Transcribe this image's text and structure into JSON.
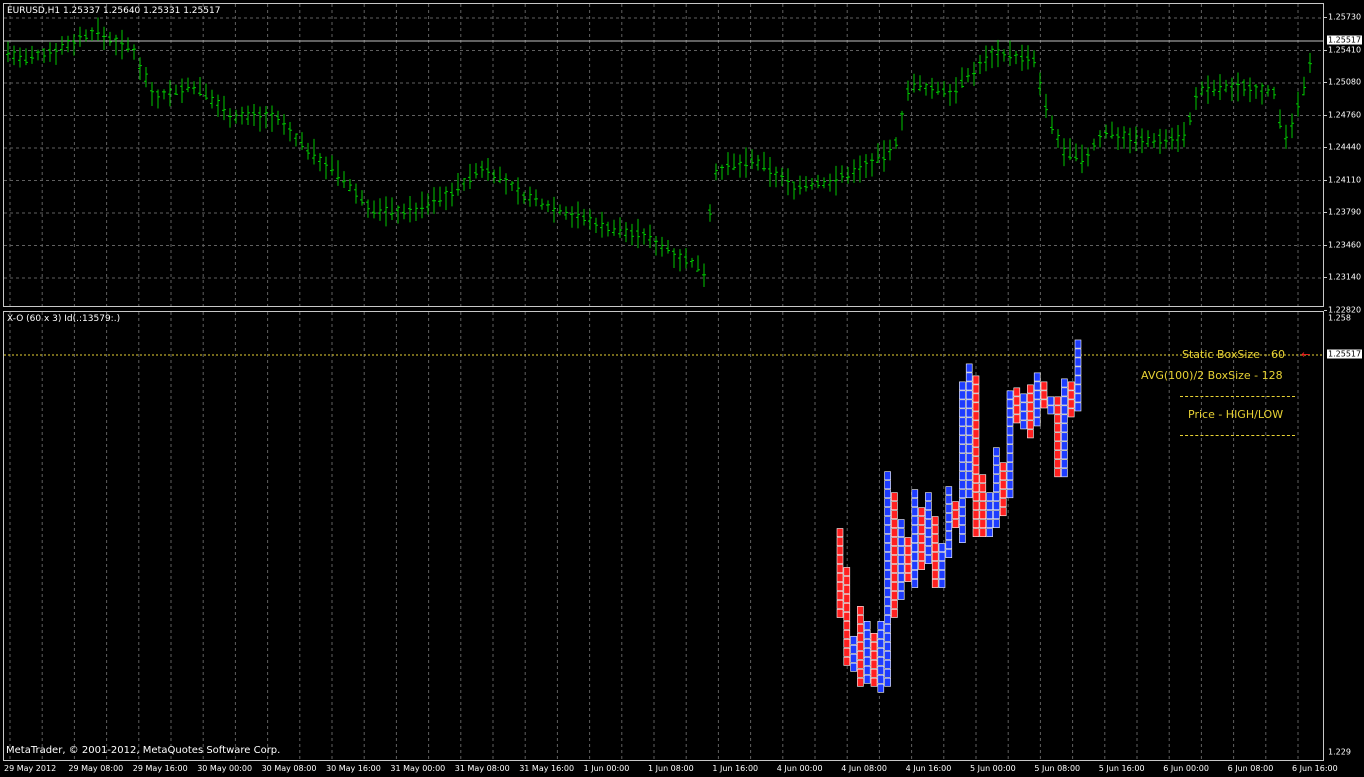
{
  "price_chart": {
    "title": "EURUSD,H1  1.25337 1.25640 1.25331 1.25517",
    "axis_labels": [
      "1.25730",
      "1.25410",
      "1.25080",
      "1.24760",
      "1.24440",
      "1.24110",
      "1.23790",
      "1.23460",
      "1.23140",
      "1.22820"
    ],
    "current_price": "1.25517"
  },
  "xo_chart": {
    "title": "X-O (60 x 3) Id(.:13579:.)",
    "axis_top": "1.258",
    "axis_bottom": "1.229",
    "current_price": "1.25517",
    "x_color": "#1e3cff",
    "o_color": "#ff2020",
    "columns": [
      {
        "type": "O",
        "top": 1.244,
        "bottom": 1.238
      },
      {
        "type": "O",
        "top": 1.2412,
        "bottom": 1.2348
      },
      {
        "type": "X",
        "top": 1.2366,
        "bottom": 1.2344
      },
      {
        "type": "O",
        "top": 1.2384,
        "bottom": 1.2334
      },
      {
        "type": "X",
        "top": 1.2378,
        "bottom": 1.2336
      },
      {
        "type": "O",
        "top": 1.2366,
        "bottom": 1.2334
      },
      {
        "type": "X",
        "top": 1.2374,
        "bottom": 1.233
      },
      {
        "type": "X",
        "top": 1.2474,
        "bottom": 1.2334
      },
      {
        "type": "O",
        "top": 1.246,
        "bottom": 1.238
      },
      {
        "type": "X",
        "top": 1.2444,
        "bottom": 1.2392
      },
      {
        "type": "O",
        "top": 1.243,
        "bottom": 1.2404
      },
      {
        "type": "X",
        "top": 1.2466,
        "bottom": 1.24
      },
      {
        "type": "O",
        "top": 1.2454,
        "bottom": 1.2412
      },
      {
        "type": "X",
        "top": 1.246,
        "bottom": 1.2416
      },
      {
        "type": "O",
        "top": 1.2448,
        "bottom": 1.24
      },
      {
        "type": "X",
        "top": 1.243,
        "bottom": 1.24
      },
      {
        "type": "X",
        "top": 1.2466,
        "bottom": 1.242
      },
      {
        "type": "O",
        "top": 1.2456,
        "bottom": 1.244
      },
      {
        "type": "X",
        "top": 1.2534,
        "bottom": 1.243
      },
      {
        "type": "X",
        "top": 1.2548,
        "bottom": 1.246
      },
      {
        "type": "O",
        "top": 1.254,
        "bottom": 1.2434
      },
      {
        "type": "O",
        "top": 1.2472,
        "bottom": 1.2434
      },
      {
        "type": "X",
        "top": 1.246,
        "bottom": 1.2434
      },
      {
        "type": "X",
        "top": 1.249,
        "bottom": 1.244
      },
      {
        "type": "O",
        "top": 1.2484,
        "bottom": 1.2448
      },
      {
        "type": "X",
        "top": 1.2528,
        "bottom": 1.246
      },
      {
        "type": "O",
        "top": 1.2532,
        "bottom": 1.251
      },
      {
        "type": "X",
        "top": 1.2528,
        "bottom": 1.2506
      },
      {
        "type": "O",
        "top": 1.2536,
        "bottom": 1.25
      },
      {
        "type": "X",
        "top": 1.2542,
        "bottom": 1.2508
      },
      {
        "type": "O",
        "top": 1.2536,
        "bottom": 1.252
      },
      {
        "type": "X",
        "top": 1.2528,
        "bottom": 1.2516
      },
      {
        "type": "O",
        "top": 1.2528,
        "bottom": 1.2474
      },
      {
        "type": "X",
        "top": 1.2536,
        "bottom": 1.2474
      },
      {
        "type": "O",
        "top": 1.2534,
        "bottom": 1.2514
      },
      {
        "type": "X",
        "top": 1.2562,
        "bottom": 1.2518
      }
    ]
  },
  "indicator": {
    "static_boxsize": "Static BoxSize - 60",
    "avg_boxsize": "AVG(100)/2 BoxSize - 128",
    "price_mode": "Price - HIGH/LOW"
  },
  "time_axis": [
    "29 May 2012",
    "29 May 08:00",
    "29 May 16:00",
    "30 May 00:00",
    "30 May 08:00",
    "30 May 16:00",
    "31 May 00:00",
    "31 May 08:00",
    "31 May 16:00",
    "1 Jun 00:00",
    "1 Jun 08:00",
    "1 Jun 16:00",
    "4 Jun 00:00",
    "4 Jun 08:00",
    "4 Jun 16:00",
    "5 Jun 00:00",
    "5 Jun 08:00",
    "5 Jun 16:00",
    "6 Jun 00:00",
    "6 Jun 08:00",
    "6 Jun 16:00"
  ],
  "footer": {
    "copyright": "MetaTrader, © 2001-2012, MetaQuotes Software Corp."
  },
  "colors": {
    "bars": "#00c800",
    "grid": "#606060",
    "frame": "#c8c8c8",
    "label": "#e8d234"
  }
}
